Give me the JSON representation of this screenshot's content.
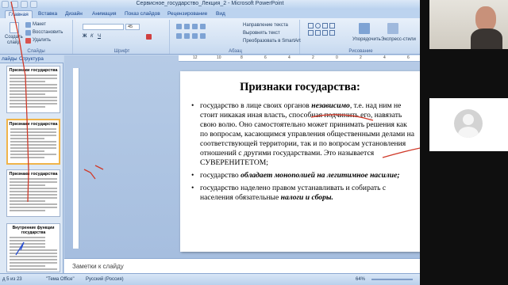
{
  "window": {
    "title": "Сервисное_государство_Лекция_2 - Microsoft PowerPoint"
  },
  "ribbon": {
    "tabs": [
      "Главная",
      "Вставка",
      "Дизайн",
      "Анимация",
      "Показ слайдов",
      "Рецензирование",
      "Вид"
    ],
    "active_tab": "Главная",
    "groups": {
      "slides": "Слайды",
      "font": "Шрифт",
      "paragraph": "Абзац",
      "drawing": "Рисование"
    },
    "labels": {
      "create_slide": "Создать",
      "create_slide_line2": "слайд",
      "layout": "Макет",
      "restore": "Восстановить",
      "delete": "Удалить",
      "text_direction": "Направление текста",
      "align_text": "Выровнять текст",
      "convert_smartart": "Преобразовать в SmartArt",
      "arrange": "Упорядочить",
      "quick_styles": "Экспресс-стили"
    },
    "font_size": "45"
  },
  "panel": {
    "tab_slides": "лайды",
    "tab_outline": "Структура",
    "thumbnails": [
      {
        "num": "",
        "title": "Признаки государства",
        "selected": false
      },
      {
        "num": "",
        "title": "Признаки государства",
        "selected": true
      },
      {
        "num": "",
        "title": "Признаки государства",
        "selected": false
      },
      {
        "num": "",
        "title": "Внутренние функции государства",
        "selected": false
      }
    ]
  },
  "slide": {
    "title": "Признаки государства:",
    "bullets": [
      {
        "parts": [
          {
            "t": "государство в лице своих органов ",
            "em": false
          },
          {
            "t": "независимо",
            "em": true
          },
          {
            "t": ", т.е. над ним не стоит никакая иная власть, способная подчинить его, навязать свою волю. Оно самостоятельно может принимать решения как по вопросам, касающимся управления общественными делами на соответствующей территории, так и по вопросам установления отношений с другими государствами. Это называется СУВЕРЕНИТЕТОМ;",
            "em": false
          }
        ]
      },
      {
        "parts": [
          {
            "t": "государство ",
            "em": false
          },
          {
            "t": "обладает монополией на легитимное насилие;",
            "em": true
          }
        ]
      },
      {
        "parts": [
          {
            "t": "государство наделено правом устанавливать и собирать с населения обязательные ",
            "em": false
          },
          {
            "t": "налоги и сборы.",
            "em": true
          }
        ]
      }
    ]
  },
  "notes": {
    "placeholder": "Заметки к слайду"
  },
  "status": {
    "slide_counter": "д 5 из 23",
    "theme": "\"Тема Office\"",
    "language": "Русский (Россия)",
    "zoom": "64%"
  }
}
